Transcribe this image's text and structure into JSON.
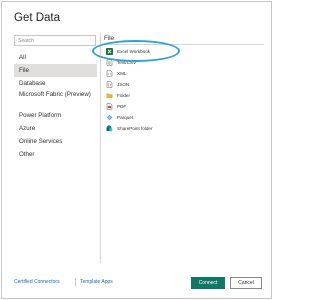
{
  "dialog": {
    "title": "Get Data"
  },
  "search": {
    "placeholder": "Search"
  },
  "categories": [
    {
      "label": "All"
    },
    {
      "label": "File"
    },
    {
      "label": "Database"
    },
    {
      "label": "Microsoft Fabric (Preview)"
    },
    {
      "label": "Power Platform"
    },
    {
      "label": "Azure"
    },
    {
      "label": "Online Services"
    },
    {
      "label": "Other"
    }
  ],
  "selected_category": "File",
  "section_title": "File",
  "items": [
    {
      "label": "Excel Workbook",
      "icon": "excel-icon"
    },
    {
      "label": "Text/CSV",
      "icon": "text-file-icon"
    },
    {
      "label": "XML",
      "icon": "xml-file-icon"
    },
    {
      "label": "JSON",
      "icon": "json-file-icon"
    },
    {
      "label": "Folder",
      "icon": "folder-icon"
    },
    {
      "label": "PDF",
      "icon": "pdf-icon"
    },
    {
      "label": "Parquet",
      "icon": "parquet-icon"
    },
    {
      "label": "SharePoint folder",
      "icon": "sharepoint-icon"
    }
  ],
  "footer": {
    "certified_connectors": "Certified Connectors",
    "template_apps": "Template Apps",
    "connect_label": "Connect",
    "cancel_label": "Cancel"
  },
  "colors": {
    "accent": "#117865",
    "highlight": "#2aa3d6",
    "link": "#0f6cbd",
    "selected_bg": "#e1dfdd"
  }
}
